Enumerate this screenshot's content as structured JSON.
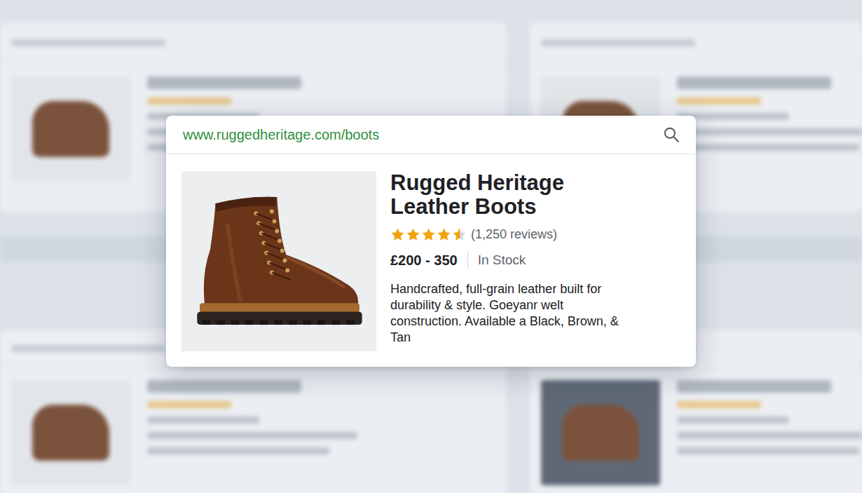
{
  "search_result": {
    "url": "www.ruggedheritage.com/boots",
    "title": "Rugged Heritage Leather Boots",
    "rating": {
      "stars": 4.5,
      "reviews": "(1,250 reviews)"
    },
    "price": "£200 - 350",
    "availability": "In Stock",
    "description": "Handcrafted, full-grain leather built for durability & style. Goeyanr welt construction. Available a Black, Brown, & Tan"
  }
}
